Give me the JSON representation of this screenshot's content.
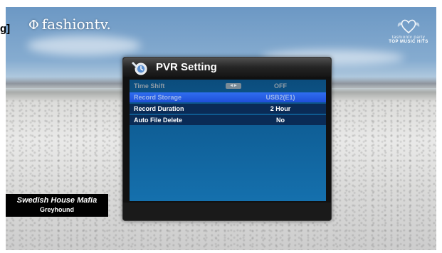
{
  "brand": {
    "name": "fashiontv.",
    "glyph": "Φ"
  },
  "edge_text": "g]",
  "party_logo": {
    "line1": "fashiontv party",
    "line2": "TOP MUSIC HITS"
  },
  "now_playing": {
    "artist": "Swedish House Mafia",
    "track": "Greyhound"
  },
  "menu": {
    "title": "PVR Setting",
    "icon": "pvr-settings-icon",
    "rows": [
      {
        "label": "Time Shift",
        "value": "OFF",
        "state": "disabled",
        "arrows": "◂ ▸"
      },
      {
        "label": "Record Storage",
        "value": "USB2(E1)",
        "state": "selected"
      },
      {
        "label": "Record Duration",
        "value": "2 Hour",
        "state": "normal"
      },
      {
        "label": "Auto File Delete",
        "value": "No",
        "state": "normal"
      }
    ]
  },
  "colors": {
    "selected_row": "#2f6ef0",
    "menu_body": "#0f5f97",
    "row_bg": "#0a2b56"
  }
}
